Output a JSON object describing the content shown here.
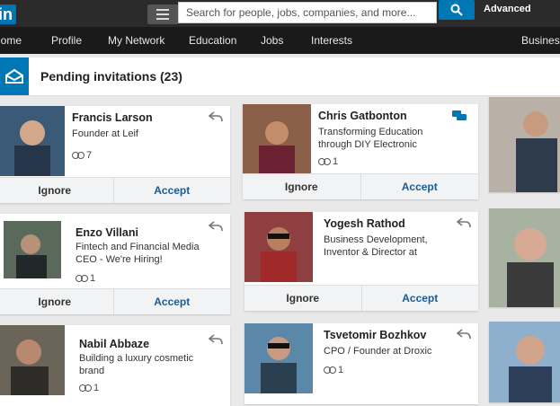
{
  "topbar": {
    "logo_text": "in",
    "search_placeholder": "Search for people, jobs, companies, and more...",
    "advanced_label": "Advanced"
  },
  "nav": {
    "items": [
      "Home",
      "Profile",
      "My Network",
      "Education",
      "Jobs",
      "Interests",
      "Business"
    ]
  },
  "header": {
    "title": "Pending invitations (23)"
  },
  "buttons": {
    "ignore": "Ignore",
    "accept": "Accept"
  },
  "invitations": [
    {
      "name": "Francis Larson",
      "title": "Founder at Leif",
      "connections": "7",
      "photo_color": "#3a5a78"
    },
    {
      "name": "Chris Gatbonton",
      "title": "Transforming Education through DIY Electronic",
      "connections": "1",
      "photo_color": "#8a6048"
    },
    {
      "name": "Enzo Villani",
      "title": "Fintech and Financial Media CEO - We're Hiring!",
      "connections": "1",
      "photo_color": "#5a6a5a"
    },
    {
      "name": "Yogesh Rathod",
      "title": "Business Development, Inventor & Director at",
      "connections": "",
      "photo_color": "#8f3f3f"
    },
    {
      "name": "Nabil Abbaze",
      "title": "Building a luxury cosmetic brand",
      "connections": "1",
      "photo_color": "#6b6458"
    },
    {
      "name": "Tsvetomir Bozhkov",
      "title": "CPO / Founder at Droxic",
      "connections": "1",
      "photo_color": "#5b87a8"
    }
  ],
  "colors": {
    "brand": "#0077b5",
    "accept_text": "#1a5b96",
    "topbar_bg": "#2b2b2b",
    "navbar_bg": "#1a1a1a"
  }
}
